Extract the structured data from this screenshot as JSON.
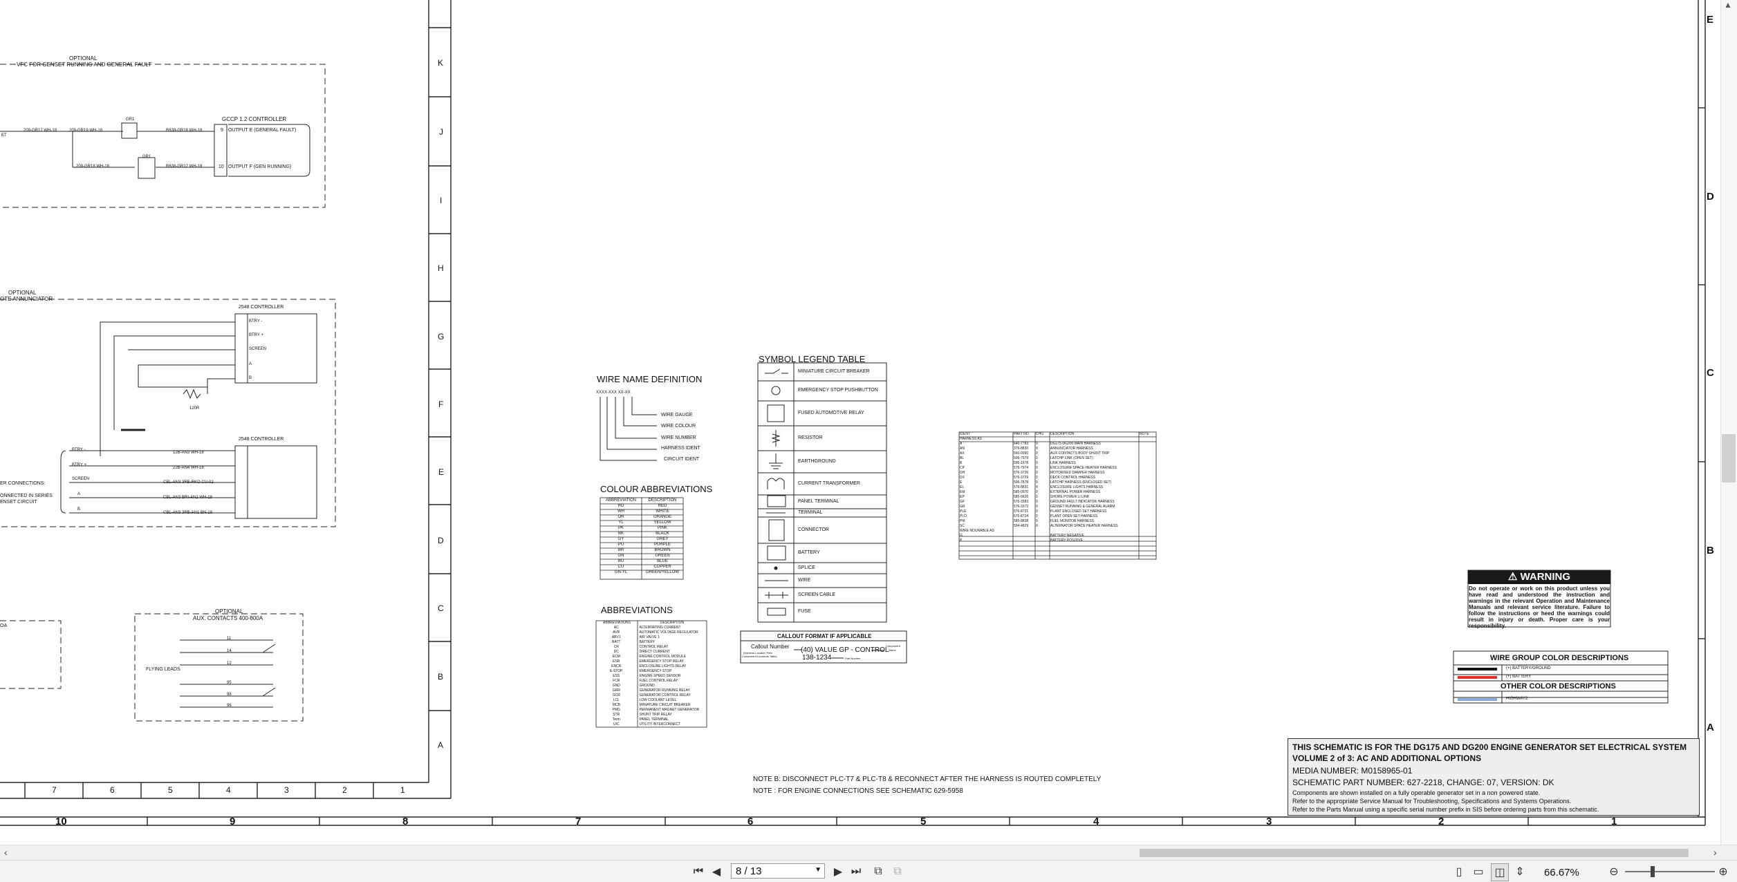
{
  "drawing": {
    "border_rows_left": [
      "K",
      "J",
      "I",
      "H",
      "G",
      "F",
      "E",
      "D",
      "C",
      "B",
      "A"
    ],
    "border_cols_left": [
      "7",
      "6",
      "5",
      "4",
      "3",
      "2",
      "1"
    ],
    "bottom_cols": [
      "10",
      "9",
      "8",
      "7",
      "6",
      "5",
      "4",
      "3",
      "2",
      "1"
    ],
    "right_rows": [
      "E",
      "D",
      "C",
      "B",
      "A"
    ],
    "vfc_box": {
      "optional": "OPTIONAL",
      "title": "VFC FOR GENSET RUNNING AND GENERAL FAULT",
      "controller": "GCCP 1.2 CONTROLLER",
      "w1": "209-GR17 WH-18",
      "w2": "209-GR19 WH-18",
      "w3": "209-GR18 WH-18",
      "w4": "R638-GR18 WH-18",
      "w5": "R638-GR12 WH-18",
      "out1": "OUTPUT E (GENERAL FAULT)",
      "out2": "OUTPUT F (GEN RUNNING)",
      "pin1": "9",
      "pin2": "10",
      "cr1": "GR1",
      "cr2": "GR1",
      "left_tag": "ET"
    },
    "annunciator_box": {
      "optional": "OPTIONAL",
      "title": "OTE ANNUNCIATOR",
      "ctrl_top": "2548 CONTROLLER",
      "ctrl_bottom": "2548 CONTROLLER",
      "p_batt_neg": "BTRY -",
      "p_batt_pos": "BTRY +",
      "p_screen": "SCREEN",
      "p_a": "A",
      "p_b": "B",
      "resistor": "120R",
      "wire1": "12B-AN3 WH-18",
      "wire2": "22B-AN4 WH-18",
      "wire3": "CBL-AN3 3RB-RKO CU-02",
      "wire4": "CBL-AN3 BRI-AN2 WH-18",
      "wire5": "CBL-AN3 3RB-AN1 BN-18",
      "note1": "ER CONNECTIONS:",
      "note2": "ONNECTED IN SERIES",
      "note3": "ENSET CIRCUIT",
      "left_btry_neg": "BTRY -",
      "left_btry_pos": "BTRY +",
      "left_screen": "SCREEN",
      "left_a": "A",
      "left_b": "B"
    },
    "aux_box": {
      "optional": "OPTIONAL",
      "title": "AUX. CONTACTS 400-800A",
      "flying": "FLYING LEADS",
      "t11": "11",
      "t14": "14",
      "t12": "12",
      "t95": "95",
      "t98": "98",
      "t96": "96",
      "left_tag": "OA"
    },
    "wire_name_def": {
      "title": "WIRE NAME DEFINITION",
      "code": "XXXX-XXX XX-XX",
      "l1": "WIRE GAUGE",
      "l2": "WIRE COLOUR",
      "l3": "WIRE NUMBER",
      "l4": "HARNESS IDENT",
      "l5": "CIRCUIT IDENT"
    },
    "colour_abbr": {
      "title": "COLOUR ABBREVIATIONS",
      "headers": [
        "ABBREVIATION",
        "DESCRIPTION"
      ],
      "rows": [
        [
          "RD",
          "RED"
        ],
        [
          "WH",
          "WHITE"
        ],
        [
          "OR",
          "ORANGE"
        ],
        [
          "YL",
          "YELLOW"
        ],
        [
          "PK",
          "PINK"
        ],
        [
          "BK",
          "BLACK"
        ],
        [
          "GY",
          "GREY"
        ],
        [
          "PU",
          "PURPLE"
        ],
        [
          "BR",
          "BROWN"
        ],
        [
          "GN",
          "GREEN"
        ],
        [
          "BU",
          "BLUE"
        ],
        [
          "CU",
          "COPPER"
        ],
        [
          "GN-YL",
          "GREEN/YELLOW"
        ]
      ]
    },
    "abbreviations": {
      "title": "ABBREVIATIONS",
      "headers": [
        "ABBREVIATIONS",
        "DESCRIPTION"
      ],
      "rows": [
        [
          "AC",
          "ALTERNATING CURRENT"
        ],
        [
          "AVR",
          "AUTOMATIC VOLTAGE REGULATOR"
        ],
        [
          "ABV1",
          "AIR VALVE 1"
        ],
        [
          "BATT",
          "BATTERY"
        ],
        [
          "CR",
          "CONTROL RELAY"
        ],
        [
          "DC",
          "DIRECT CURRENT"
        ],
        [
          "ECM",
          "ENGINE CONTROL MODULE"
        ],
        [
          "ESR",
          "EMERGENCY STOP RELAY"
        ],
        [
          "ENCR",
          "ENCLOSURE LIGHTS RELAY"
        ],
        [
          "E-STOP",
          "EMERGENCY STOP"
        ],
        [
          "ESS",
          "ENGINE SPEED SENSOR"
        ],
        [
          "FCR",
          "FUEL CONTROL RELAY"
        ],
        [
          "GND",
          "GROUND"
        ],
        [
          "GRR",
          "GENERATOR RUNNING RELAY"
        ],
        [
          "GCR",
          "GENERATOR CONTROL RELAY"
        ],
        [
          "LCL",
          "LOW COOLANT LEVEL"
        ],
        [
          "MCB",
          "MINIATURE CIRCUIT BREAKER"
        ],
        [
          "PMG",
          "PERMANENT MAGNET GENERATOR"
        ],
        [
          "STR",
          "SHUNT TRIP RELAY"
        ],
        [
          "Term",
          "PANEL TERMINAL"
        ],
        [
          "UIC",
          "UTILITY INTERCONNECT"
        ]
      ]
    },
    "symbol_legend": {
      "title": "SYMBOL LEGEND TABLE",
      "rows": [
        "MINIATURE CIRCUIT BREAKER",
        "EMERGENCY STOP PUSHBUTTON",
        "FUSED AUTOMOTIVE RELAY",
        "RESISTOR",
        "EARTHGROUND",
        "CURRENT TRANSFORMER",
        "PANEL TERMINAL",
        "TERMINAL",
        "CONNECTOR",
        "BATTERY",
        "SPLICE",
        "WIRE",
        "SCREEN CABLE",
        "FUSE"
      ]
    },
    "callout": {
      "title": "CALLOUT FORMAT IF APPLICABLE",
      "left1": "Callout Number",
      "left2": "(Harness Location Path",
      "left3": "Component Locations Table)",
      "main": "(40) VALUE GP - CONTROL",
      "part": "138-1234",
      "part_label": "Part Number",
      "comp1": "Component",
      "comp2": "Name"
    },
    "harness_table": {
      "headers": [
        "IDENT",
        "PART NO.",
        "CHG",
        "DESCRIPTION",
        "NOTE"
      ],
      "section1": "HARNESS AS",
      "rows": [
        [
          "A",
          "640-7783",
          "0",
          "DG175-DG200 MAIN HARNESS"
        ],
        [
          "AN",
          "376-8830",
          "0",
          "ANNUNCIATOR HARNESS"
        ],
        [
          "AX",
          "560-0060",
          "0",
          "AUX CONTACTS BODY SHUNT TRIP"
        ],
        [
          "BL",
          "596-7979",
          "0",
          "LATCHP LINK (OPEN SET)"
        ],
        [
          "B",
          "595-1978",
          "0",
          "LINK HARNESS"
        ],
        [
          "CP",
          "576-7974",
          "0",
          "ENCLOSURE SPACE HEATER HARNESS"
        ],
        [
          "DH",
          "576-3726",
          "0",
          "MOTORISED DAMPER HARNESS"
        ],
        [
          "DX",
          "576-3729",
          "0",
          "DECK CONTROL HARNESS"
        ],
        [
          "E",
          "596-7878",
          "0",
          "LATCHP HARNESS (ENCLOSED SET)"
        ],
        [
          "EL",
          "576-8831",
          "0",
          "ENCLOSURE LIGHTS HARNESS"
        ],
        [
          "EM",
          "585-0970",
          "0",
          "EXTERNAL POWER HARNESS"
        ],
        [
          "EP",
          "585-6626",
          "0",
          "SHORE POWER LI LINK"
        ],
        [
          "GF",
          "576-3383",
          "0",
          "GROUND FAULT INDICATOR HARNESS"
        ],
        [
          "GR",
          "576-3372",
          "0",
          "GENSET RUNNING & GENERAL ALARM"
        ],
        [
          "PLE",
          "576-8721",
          "0",
          "PLANT ENCLOSED SET HARNESS"
        ],
        [
          "PLO",
          "576-8724",
          "0",
          "PLANT OPEN SET HARNESS"
        ],
        [
          "PM",
          "585-8838",
          "0",
          "FUEL MONITOR HARNESS"
        ],
        [
          "SC",
          "594-4829",
          "0",
          "ALTERNATOR SPACE HEATER HARNESS"
        ]
      ],
      "section2": "WIRE NOUNABLE AS",
      "rows2": [
        [
          "G",
          "",
          "",
          "BATTERY NEGATIVE"
        ],
        [
          "P",
          "",
          "",
          "BATTERY POSITIVE"
        ]
      ]
    },
    "warning": {
      "title": "WARNING",
      "text": "Do not operate or work on this product unless you have read and understood the instruction and warnings in the relevant Operation and Maintenance Manuals and relevant service literature. Failure to follow the instructions or heed the warnings could result in injury or death. Proper care is your responsibility."
    },
    "wire_group": {
      "title": "WIRE GROUP COLOR DESCRIPTIONS",
      "r1": "(+) BATTERY/GROUND",
      "r2": "(+) BATTERY",
      "title2": "OTHER COLOR DESCRIPTIONS",
      "r3": "HIGHWAY2",
      "c_black": "#111111",
      "c_red": "#e03030",
      "c_blue": "#8aaad8"
    },
    "notes": {
      "n1": "NOTE B: DISCONNECT PLC-T7 & PLC-T8 & RECONNECT AFTER THE HARNESS IS ROUTED COMPLETELY",
      "n2": "NOTE : FOR ENGINE CONNECTIONS SEE SCHEMATIC 629-5958"
    },
    "title_block": {
      "l1": "THIS SCHEMATIC IS FOR THE DG175 AND DG200 ENGINE GENERATOR SET ELECTRICAL SYSTEM",
      "l2": "VOLUME 2 of 3: AC AND ADDITIONAL OPTIONS",
      "l3": "MEDIA NUMBER: M0158965-01",
      "l4": "SCHEMATIC PART NUMBER: 627-2218, CHANGE: 07, VERSION: DK",
      "l5": "Components are shown installed on a fully operable generator set in a non powered state.",
      "l6": "Refer to the appropriate Service Manual for Troubleshooting, Specifications and Systems Operations.",
      "l7": "Refer to the Parts Manual using a specific serial number prefix in SIS before ordering parts from this schematic."
    }
  },
  "viewer": {
    "page_field": "8 / 13",
    "zoom": "66.67%",
    "icons": [
      "first-page-icon",
      "prev-page-icon",
      "next-page-icon",
      "last-page-icon",
      "fit-page-icon",
      "fit-width-icon",
      "single-page-icon",
      "facing-pages-icon",
      "continuous-icon",
      "scroll-mode-icon",
      "zoom-out-icon",
      "zoom-in-icon",
      "scroll-left-icon",
      "scroll-right-icon"
    ]
  }
}
